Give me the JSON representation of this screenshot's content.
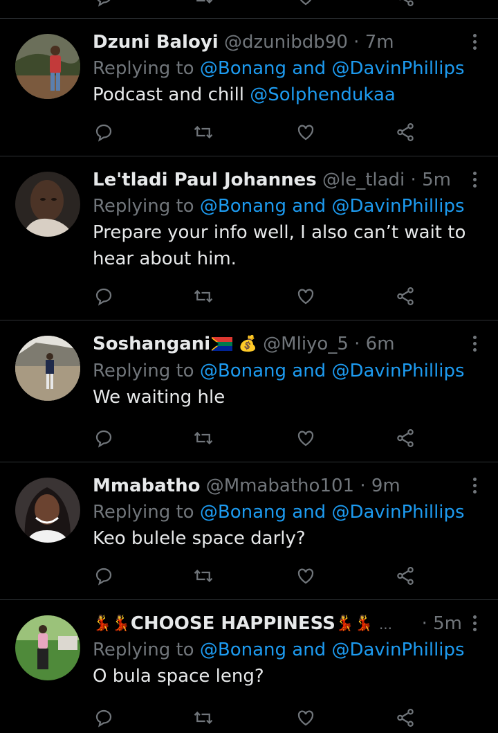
{
  "colors": {
    "background": "#000000",
    "text": "#e7e9ea",
    "muted": "#71767b",
    "link": "#1d9bf0",
    "divider": "#2f3336"
  },
  "icons": [
    "reply-icon",
    "retweet-icon",
    "like-icon",
    "share-icon",
    "more-icon"
  ],
  "tweets": [
    {
      "name": "Dzuni Baloyi",
      "handle": "@dzunibdb90",
      "sep": " · ",
      "time": "7m",
      "replying_prefix": "Replying to ",
      "replying_targets": "@Bonang and @DavinPhillips",
      "text": "Podcast and chill ",
      "mention": "@Solphendukaa"
    },
    {
      "name": "Le'tladi Paul Johannes",
      "handle": "@le_tladi",
      "sep": " · ",
      "time": "5m",
      "replying_prefix": "Replying to ",
      "replying_targets": "@Bonang and @DavinPhillips",
      "text_line1": "Prepare your info well, I also can’t wait to",
      "text_line2": "hear about him."
    },
    {
      "name": "Soshangani",
      "money_emoji": "💰",
      "handle": "@Mliyo_5",
      "sep": " · ",
      "time": "6m",
      "replying_prefix": "Replying to ",
      "replying_targets": "@Bonang and @DavinPhillips",
      "text": "We waiting hle"
    },
    {
      "name": "Mmabatho",
      "handle": "@Mmabatho101",
      "sep": " · ",
      "time": "9m",
      "replying_prefix": "Replying to ",
      "replying_targets": "@Bonang and @DavinPhillips",
      "text": "Keo bulele space darly?"
    },
    {
      "name": "CHOOSE HAPPINESS",
      "dancer_emoji": "💃",
      "ellipsis": "...",
      "sep": " · ",
      "time": "5m",
      "replying_prefix": "Replying to ",
      "replying_targets": "@Bonang and @DavinPhillips",
      "text": "O bula space leng?"
    }
  ]
}
